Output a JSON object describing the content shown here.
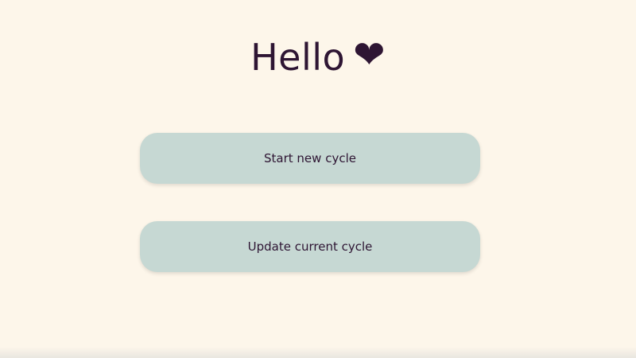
{
  "header": {
    "greeting": "Hello",
    "heart_glyph": "❤",
    "heart_icon": "heart-icon"
  },
  "actions": {
    "start_label": "Start new cycle",
    "update_label": "Update current cycle"
  },
  "colors": {
    "background": "#fdf6ea",
    "text": "#2e1533",
    "button": "#c6d8d3"
  }
}
